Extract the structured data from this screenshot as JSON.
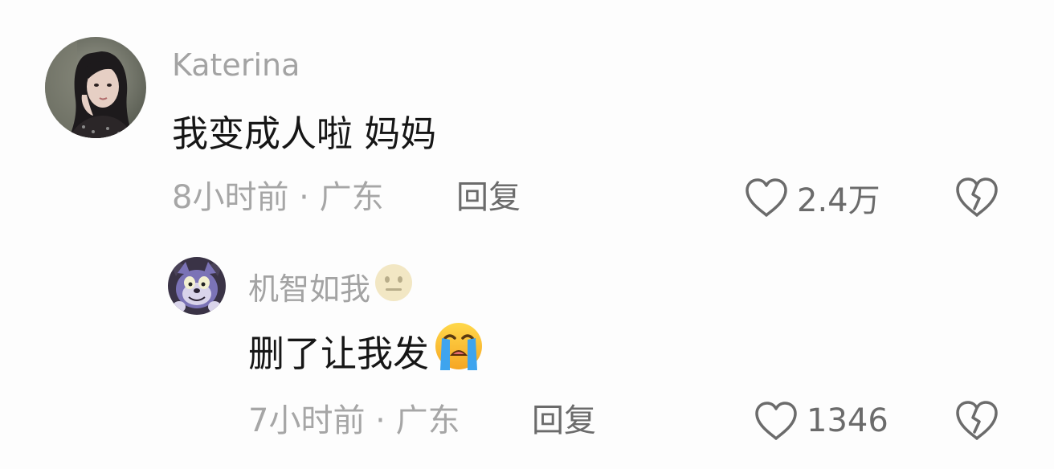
{
  "comments": [
    {
      "username": "Katerina",
      "text": "我变成人啦 妈妈",
      "time": "8小时前",
      "location": "广东",
      "reply_label": "回复",
      "like_count": "2.4万",
      "avatar_icon": "portrait-photo"
    },
    {
      "username": "机智如我",
      "username_emoji": "neutral-face-icon",
      "text": "删了让我发",
      "text_emoji": "loudly-crying-face-icon",
      "time": "7小时前",
      "location": "广东",
      "reply_label": "回复",
      "like_count": "1346",
      "avatar_icon": "cartoon-cat-avatar"
    }
  ],
  "meta_separator": " · ",
  "icons": {
    "like": "heart-outline-icon",
    "dislike": "broken-heart-icon"
  },
  "colors": {
    "background": "#fdfdfd",
    "username": "#a3a3a3",
    "text": "#161616",
    "meta": "#a6a6a6",
    "action": "#6b6b6b"
  }
}
